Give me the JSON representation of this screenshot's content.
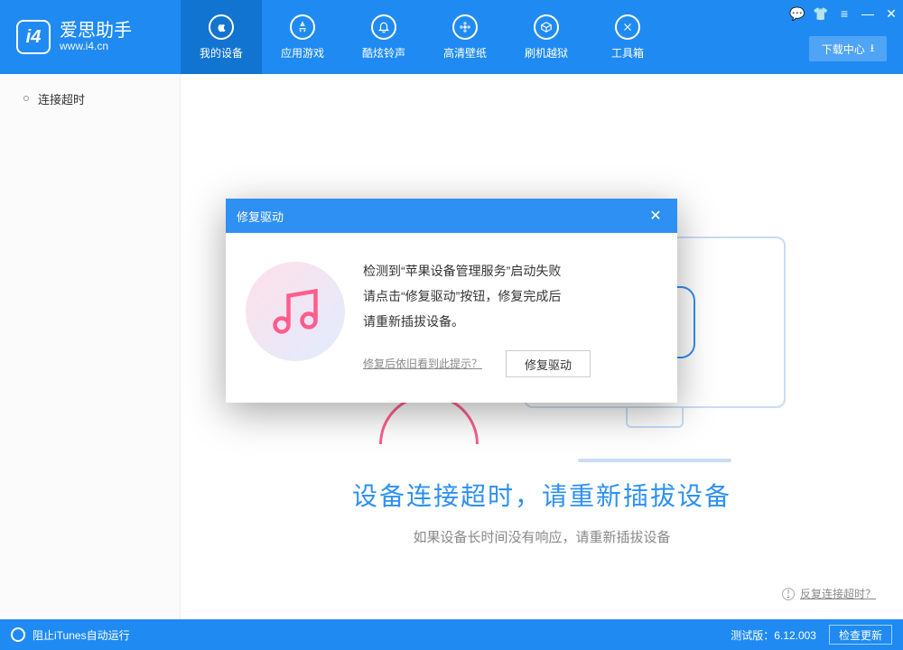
{
  "header": {
    "app_name": "爱思助手",
    "app_url": "www.i4.cn",
    "nav": [
      {
        "label": "我的设备",
        "icon": "apple-icon"
      },
      {
        "label": "应用游戏",
        "icon": "appstore-icon"
      },
      {
        "label": "酷炫铃声",
        "icon": "bell-icon"
      },
      {
        "label": "高清壁纸",
        "icon": "flower-icon"
      },
      {
        "label": "刷机越狱",
        "icon": "box-icon"
      },
      {
        "label": "工具箱",
        "icon": "tools-icon"
      }
    ],
    "window_buttons": [
      "chat-icon",
      "skin-icon",
      "menu-icon",
      "minimize-icon",
      "close-icon"
    ],
    "download_center": "下载中心"
  },
  "sidebar": {
    "items": [
      {
        "label": "连接超时"
      }
    ]
  },
  "main": {
    "title": "设备连接超时，请重新插拔设备",
    "subtitle": "如果设备长时间没有响应，请重新插拔设备",
    "feedback_link": "反复连接超时？"
  },
  "dialog": {
    "title": "修复驱动",
    "line1": "检测到“苹果设备管理服务”启动失败",
    "line2": "请点击“修复驱动”按钮，修复完成后",
    "line3": "请重新插拔设备。",
    "help_link": "修复后依旧看到此提示？",
    "button": "修复驱动"
  },
  "footer": {
    "left_text": "阻止iTunes自动运行",
    "version_label": "测试版：6.12.003",
    "check_update": "检查更新"
  }
}
